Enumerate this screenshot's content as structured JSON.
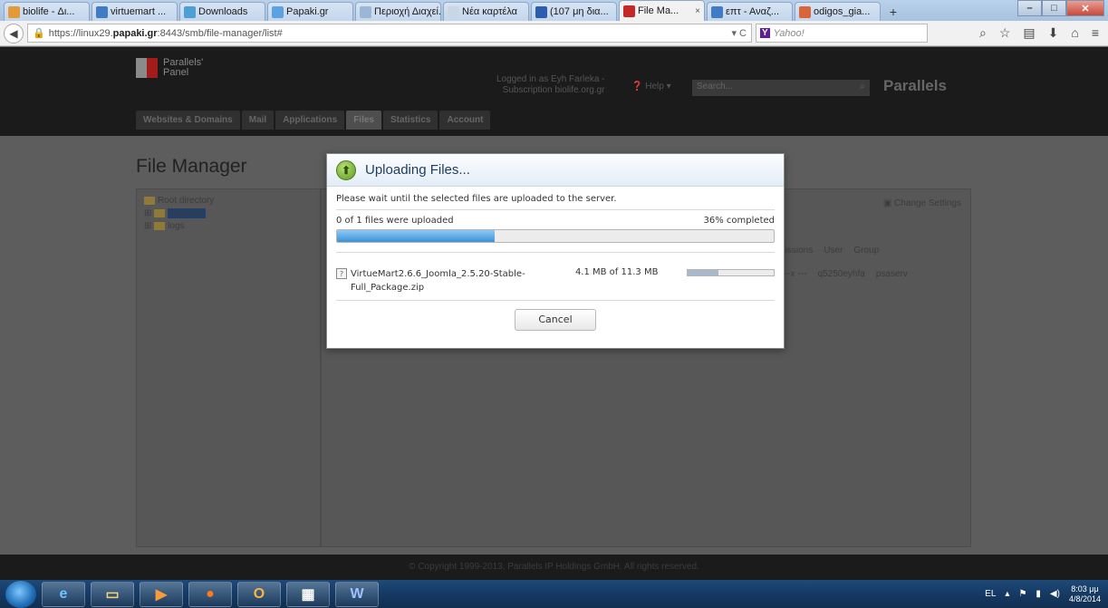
{
  "browser": {
    "tabs": [
      {
        "label": "biolife - Δι...",
        "color": "#e39b3a"
      },
      {
        "label": "virtuemart ...",
        "color": "#3f7cc4"
      },
      {
        "label": "Downloads",
        "color": "#4d9fd6"
      },
      {
        "label": "Papaki.gr",
        "color": "#5aa3e0"
      },
      {
        "label": "Περιοχή Διαχεί...",
        "color": "#9cb7d6"
      },
      {
        "label": "Νέα καρτέλα",
        "color": "#c8d6e6"
      },
      {
        "label": "(107 μη δια...",
        "color": "#2b5fae"
      },
      {
        "label": "File Ma...",
        "color": "#c62828",
        "active": true
      },
      {
        "label": "επτ - Αναζ...",
        "color": "#3f7cc4"
      },
      {
        "label": "odigos_gia...",
        "color": "#d9653a"
      }
    ],
    "url_prefix": "https://linux29.",
    "url_host": "papaki.gr",
    "url_suffix": ":8443/smb/file-manager/list#",
    "search_placeholder": "Yahoo!",
    "search_logo": "Y"
  },
  "panel": {
    "brand_line1": "Parallels'",
    "brand_line2": "Panel",
    "logged_line1": "Logged in as  Eyh Farleka -",
    "logged_line2": "Subscription  biolife.org.gr",
    "help": "Help",
    "search": "Search...",
    "logo": "Parallels",
    "tabs": [
      "Websites & Domains",
      "Mail",
      "Applications",
      "Files",
      "Statistics",
      "Account"
    ],
    "title": "File Manager",
    "tree": {
      "root": "Root directory",
      "httpdocs": "httpdocs",
      "logs": "logs"
    },
    "change_settings": "Change Settings",
    "columns": {
      "permissions": "rmissions",
      "user": "User",
      "group": "Group"
    },
    "row": {
      "permissions": "rx --x ---",
      "user": "q5250eyhfa",
      "group": "psaserv"
    },
    "footer": "© Copyright 1999-2013, Parallels IP Holdings GmbH. All rights reserved."
  },
  "dialog": {
    "title": "Uploading Files...",
    "message": "Please wait until the selected files are uploaded to the server.",
    "files_uploaded": "0 of 1 files were uploaded",
    "percent_label": "36% completed",
    "progress": 0.36,
    "file_name": "VirtueMart2.6.6_Joomla_2.5.20-Stable-Full_Package.zip",
    "file_size": "4.1 MB of 11.3 MB",
    "file_progress": 0.36,
    "cancel": "Cancel"
  },
  "taskbar": {
    "lang": "EL",
    "time": "8:03 μμ",
    "date": "4/8/2014"
  }
}
